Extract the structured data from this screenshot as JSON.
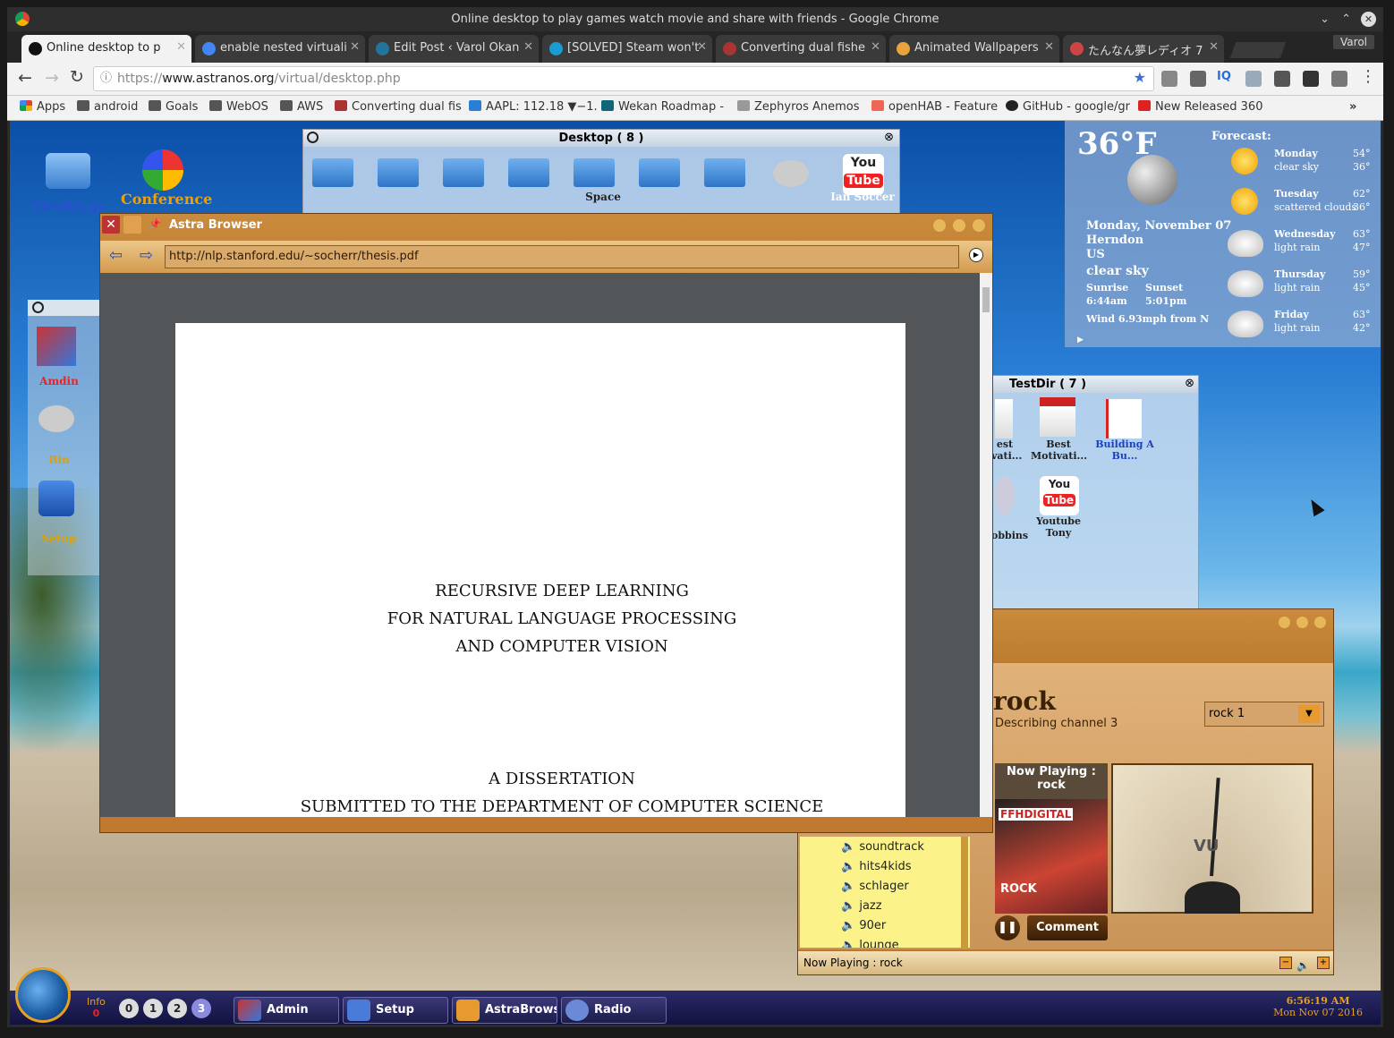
{
  "window_title": "Online desktop to play games watch movie and share with friends - Google Chrome",
  "profile": "Varol",
  "tabs": [
    {
      "label": "Online desktop to p"
    },
    {
      "label": "enable nested virtuali"
    },
    {
      "label": "Edit Post ‹ Varol Okan"
    },
    {
      "label": "[SOLVED] Steam won't"
    },
    {
      "label": "Converting dual fishe"
    },
    {
      "label": "Animated Wallpapers"
    },
    {
      "label": "たんなん夢レディオ 7"
    }
  ],
  "url_prefix": "https://",
  "url_host": "www.astranos.org",
  "url_path": "/virtual/desktop.php",
  "bookmarks": [
    "Apps",
    "android",
    "Goals",
    "WebOS",
    "AWS",
    "Converting dual fis",
    "AAPL: 112.18 ▼−1.",
    "Wekan Roadmap -",
    "Zephyros Anemos",
    "openHAB - Feature",
    "GitHub - google/gr",
    "New Released 360"
  ],
  "desktop_icons": {
    "desktop": "Desktop",
    "conference": "Conference"
  },
  "desktop_win": {
    "title": "Desktop ( 8 )",
    "icon_labels": [
      "Space",
      "Ian Soccer"
    ]
  },
  "side_panel": {
    "items": [
      "Amdin",
      "Bin",
      "Setup"
    ]
  },
  "browser": {
    "title": "Astra Browser",
    "url": "http://nlp.stanford.edu/~socherr/thesis.pdf",
    "doc_lines": [
      "RECURSIVE DEEP LEARNING",
      "FOR NATURAL LANGUAGE PROCESSING",
      "AND COMPUTER VISION",
      "A DISSERTATION",
      "SUBMITTED TO THE DEPARTMENT OF COMPUTER SCIENCE"
    ]
  },
  "weather": {
    "temp": "36°F",
    "date": "Monday, November 07",
    "city": "Herndon",
    "country": "US",
    "condition": "clear sky",
    "sunrise_label": "Sunrise",
    "sunrise": "6:44am",
    "sunset_label": "Sunset",
    "sunset": "5:01pm",
    "wind": "Wind 6.93mph from N",
    "forecast_label": "Forecast:",
    "days": [
      {
        "day": "Monday",
        "desc": "clear sky",
        "hi": "54°",
        "lo": "36°",
        "icon": "sun-icon"
      },
      {
        "day": "Tuesday",
        "desc": "scattered clouds",
        "hi": "62°",
        "lo": "36°",
        "icon": "sun-cloud-icon"
      },
      {
        "day": "Wednesday",
        "desc": "light rain",
        "hi": "63°",
        "lo": "47°",
        "icon": "rain-icon"
      },
      {
        "day": "Thursday",
        "desc": "light rain",
        "hi": "59°",
        "lo": "45°",
        "icon": "rain-icon"
      },
      {
        "day": "Friday",
        "desc": "light rain",
        "hi": "63°",
        "lo": "42°",
        "icon": "rain-icon"
      }
    ]
  },
  "testdir": {
    "title": "TestDir ( 7 )",
    "items": [
      "est\nvati...",
      "Best\nMotivati...",
      "Building A\nBu...",
      "obbins",
      "Youtube\nTony"
    ]
  },
  "radio": {
    "channel": "rock",
    "desc": "Describing channel 3",
    "select": "rock 1",
    "now_playing": "Now Playing :",
    "now_playing_name": "rock",
    "album": "FFHDIGITAL",
    "album_sub": "ROCK",
    "vu_label": "VU",
    "list": [
      "soundtrack",
      "hits4kids",
      "schlager",
      "jazz",
      "90er",
      "lounge"
    ],
    "comment": "Comment",
    "footer": "Now Playing : rock"
  },
  "taskbar": {
    "info": "Info",
    "info_count": "0",
    "workspaces": [
      "0",
      "1",
      "2",
      "3"
    ],
    "items": [
      "Admin",
      "Setup",
      "AstraBrowser",
      "Radio"
    ],
    "time": "6:56:19 AM",
    "date": "Mon Nov 07 2016"
  }
}
